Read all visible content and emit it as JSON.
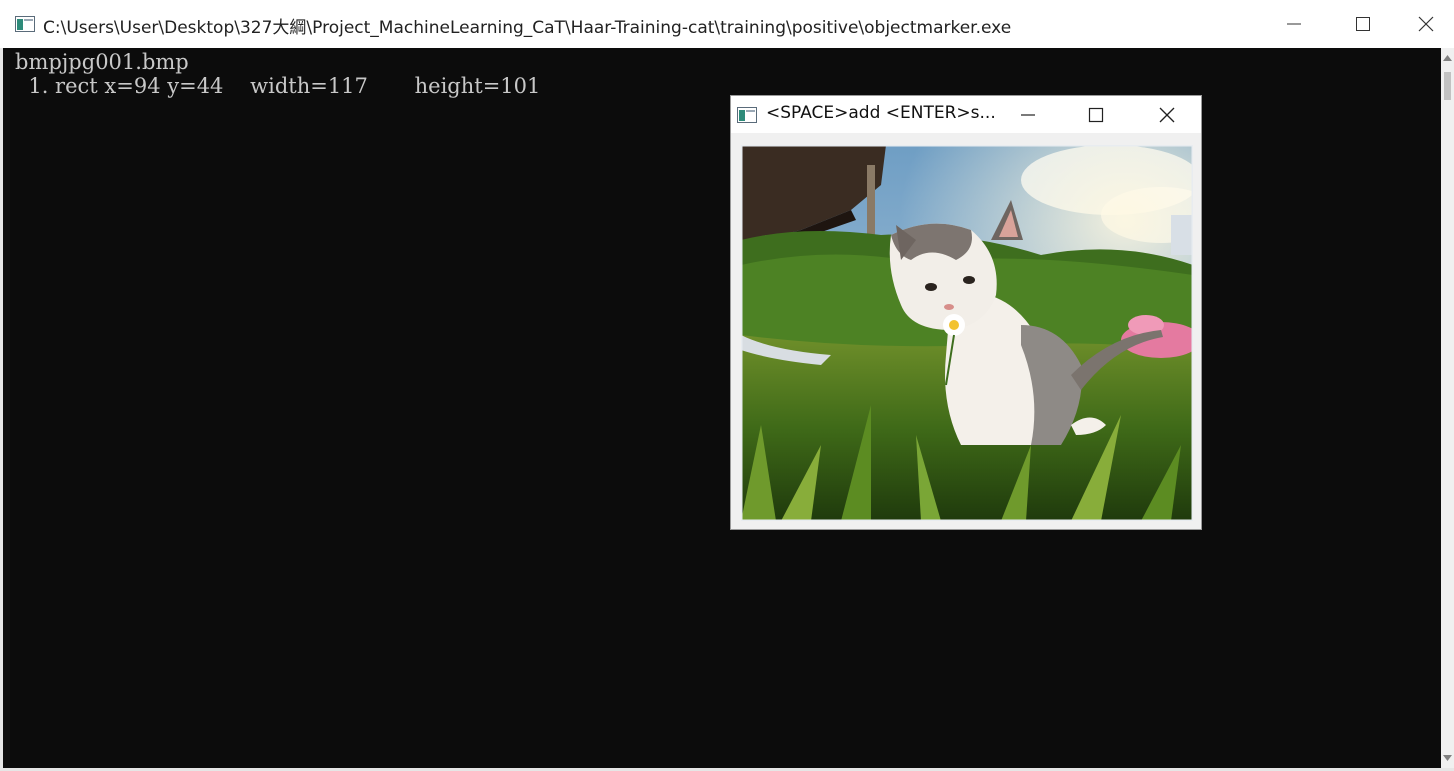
{
  "console": {
    "title": "C:\\Users\\User\\Desktop\\327大綱\\Project_MachineLearning_CaT\\Haar-Training-cat\\training\\positive\\objectmarker.exe",
    "lines": [
      "bmpjpg001.bmp",
      "  1. rect x=94 y=44    width=117       height=101"
    ]
  },
  "image_window": {
    "title": "<SPACE>add <ENTER>s...",
    "image_icon": "photo-of-kitten-smelling-daisy"
  },
  "icons": {
    "app": "console-app-icon",
    "minimize": "minimize-icon",
    "maximize": "maximize-icon",
    "close": "close-icon"
  }
}
